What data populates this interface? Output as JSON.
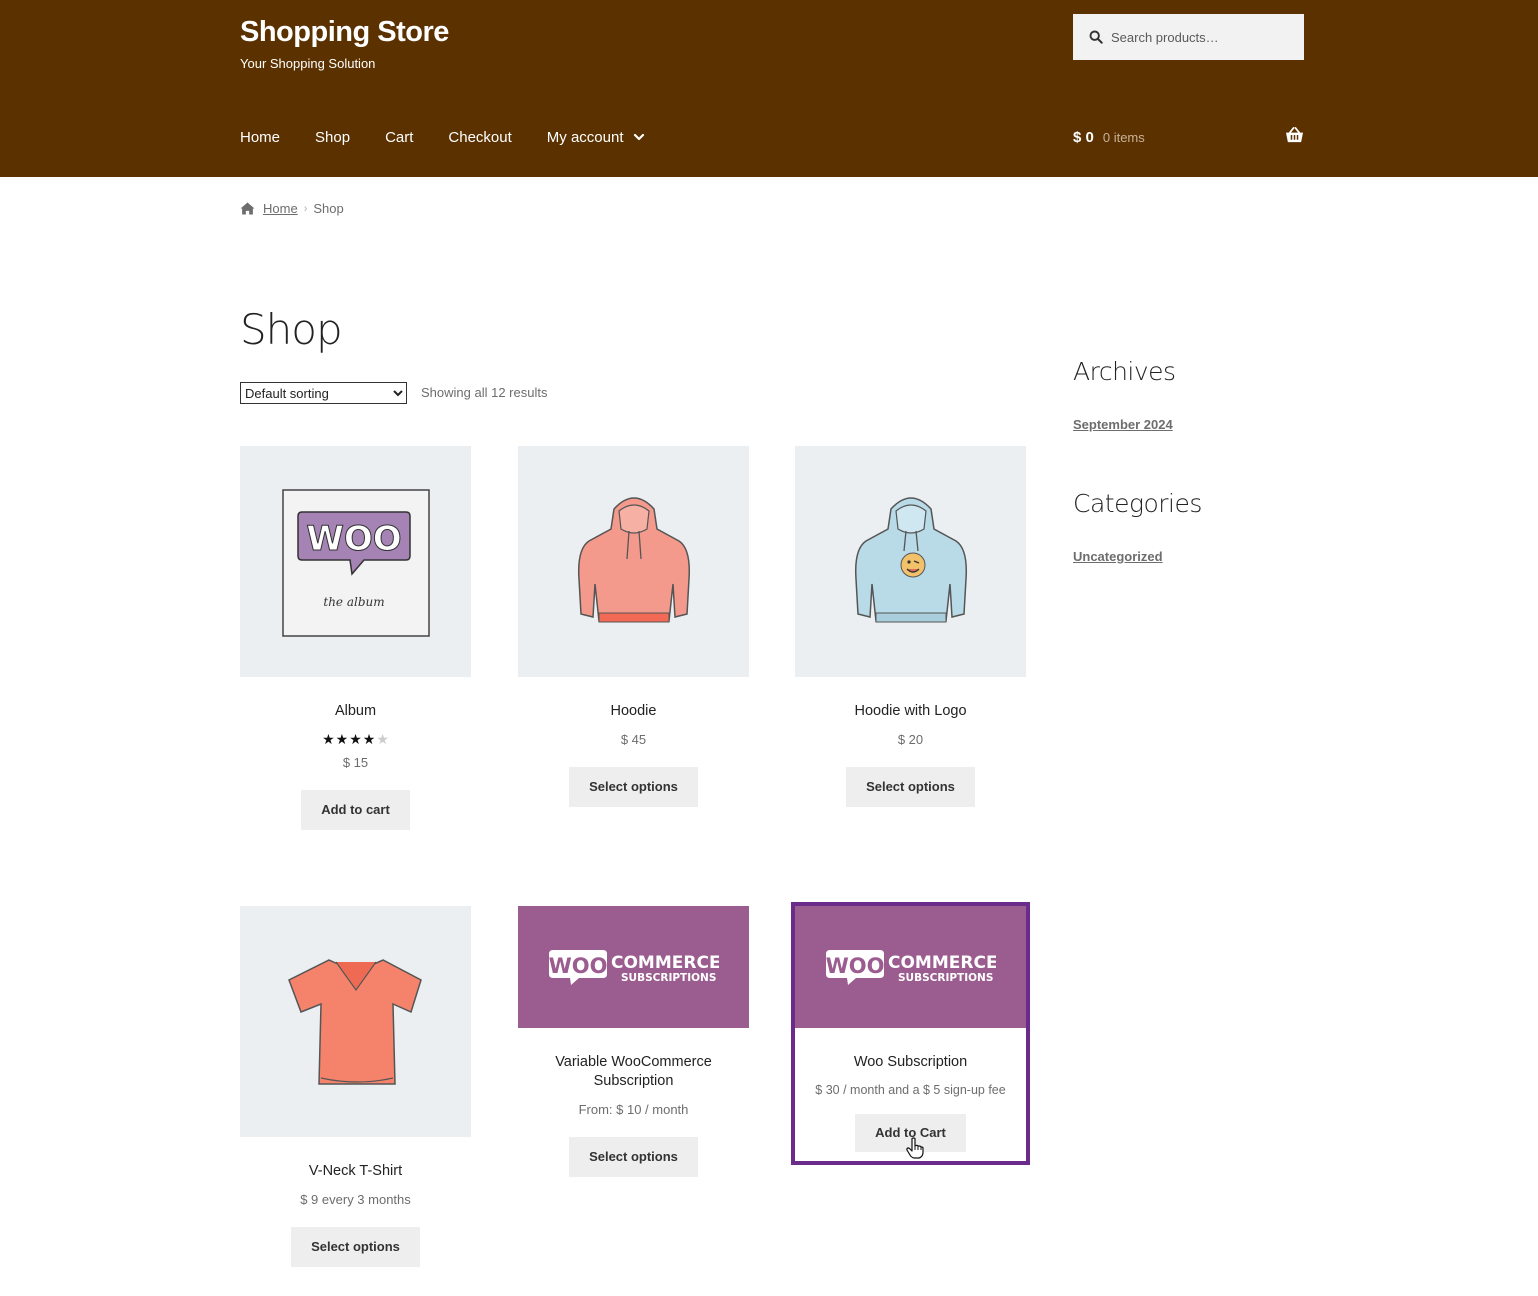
{
  "header": {
    "site_title": "Shopping Store",
    "tagline": "Your Shopping Solution",
    "search_placeholder": "Search products…",
    "nav": [
      "Home",
      "Shop",
      "Cart",
      "Checkout",
      "My account"
    ],
    "cart_amount": "$ 0",
    "cart_count": "0 items",
    "bg_color": "#5b3100"
  },
  "breadcrumb": {
    "home": "Home",
    "current": "Shop"
  },
  "page": {
    "title": "Shop",
    "sort_selected": "Default sorting",
    "sort_options": [
      "Default sorting"
    ],
    "result_count": "Showing all 12 results"
  },
  "products": [
    {
      "title": "Album",
      "price": "$ 15",
      "rating": 4,
      "button": "Add to cart",
      "image": "woo-album"
    },
    {
      "title": "Hoodie",
      "price": "$ 45",
      "button": "Select options",
      "image": "hoodie-pink"
    },
    {
      "title": "Hoodie with Logo",
      "price": "$ 20",
      "button": "Select options",
      "image": "hoodie-blue"
    },
    {
      "title": "V-Neck T-Shirt",
      "price": "$ 9 every 3 months",
      "button": "Select options",
      "image": "tshirt"
    },
    {
      "title": "Variable WooCommerce Subscription",
      "title_line1": "Variable WooCommerce",
      "title_line2": "Subscription",
      "price": "From: $ 10 / month",
      "button": "Select options",
      "image": "woocommerce-subscriptions"
    },
    {
      "title": "Woo Subscription",
      "price": "$ 30 / month and a $ 5 sign-up fee",
      "button": "Add to Cart",
      "image": "woocommerce-subscriptions"
    }
  ],
  "logo_text": {
    "woo": "WOO",
    "commerce": "COMMERCE",
    "subscriptions": "SUBSCRIPTIONS",
    "album_small": "the album"
  },
  "sidebar": {
    "archives_title": "Archives",
    "archives_link": "September 2024",
    "categories_title": "Categories",
    "categories_link": "Uncategorized"
  }
}
